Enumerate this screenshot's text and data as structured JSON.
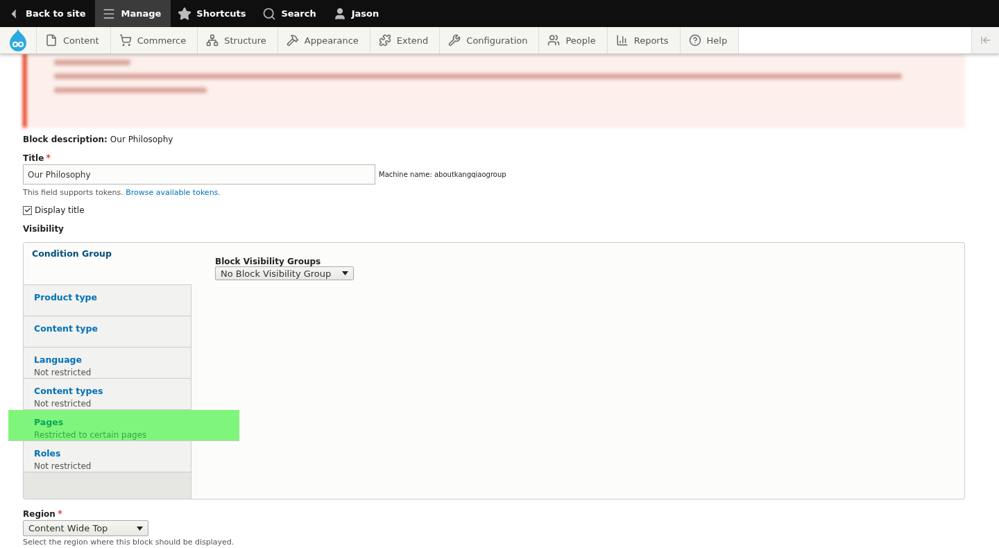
{
  "top_bar": {
    "items": [
      {
        "label": "Back to site",
        "selected": false
      },
      {
        "label": "Manage",
        "selected": true
      },
      {
        "label": "Shortcuts",
        "selected": false
      },
      {
        "label": "Search",
        "selected": false
      },
      {
        "label": "Jason",
        "selected": false
      }
    ]
  },
  "tray": {
    "items": [
      {
        "label": "Content"
      },
      {
        "label": "Commerce"
      },
      {
        "label": "Structure"
      },
      {
        "label": "Appearance"
      },
      {
        "label": "Extend"
      },
      {
        "label": "Configuration"
      },
      {
        "label": "People"
      },
      {
        "label": "Reports"
      },
      {
        "label": "Help"
      }
    ]
  },
  "form": {
    "block_description": {
      "label": "Block description:",
      "value": "Our Philosophy"
    },
    "title": {
      "label": "Title",
      "required_mark": "*",
      "value": "Our Philosophy",
      "machine_name": "Machine name: aboutkangqiaogroup",
      "help": "This field supports tokens.",
      "help_link": "Browse available tokens."
    },
    "display_title": {
      "label": "Display title",
      "checked": true
    },
    "visibility": {
      "label": "Visibility",
      "tabs": [
        {
          "title": "Condition Group",
          "selected": true,
          "highlighted": false
        },
        {
          "title": "Product type",
          "selected": false,
          "highlighted": false
        },
        {
          "title": "Content type",
          "selected": false,
          "highlighted": false
        },
        {
          "title": "Language",
          "summary": "Not restricted",
          "selected": false,
          "highlighted": false
        },
        {
          "title": "Content types",
          "summary": "Not restricted",
          "selected": false,
          "highlighted": false
        },
        {
          "title": "Pages",
          "summary": "Restricted to certain pages",
          "selected": false,
          "highlighted": true
        },
        {
          "title": "Roles",
          "summary": "Not restricted",
          "selected": false,
          "highlighted": false
        }
      ],
      "pane": {
        "label": "Block Visibility Groups",
        "value": "No Block Visibility Group"
      }
    },
    "region": {
      "label": "Region",
      "required_mark": "*",
      "value": "Content Wide Top",
      "help": "Select the region where this block should be displayed."
    }
  }
}
